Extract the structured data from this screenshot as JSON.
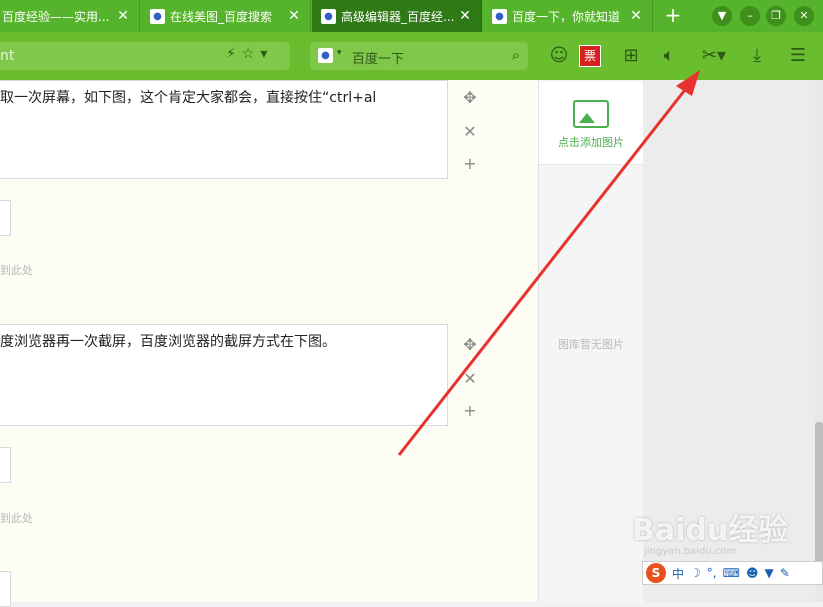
{
  "tabs": [
    {
      "title": "百度经验——实用..."
    },
    {
      "title": "在线美图_百度搜索"
    },
    {
      "title": "高级编辑器_百度经..."
    },
    {
      "title": "百度一下，你就知道"
    }
  ],
  "address": {
    "value": "nt"
  },
  "search": {
    "placeholder": "百度一下"
  },
  "toolbar": {
    "ticket": "票"
  },
  "editor": {
    "block1_text": "取一次屏幕，如下图，这个肯定大家都会，直接按住“ctrl+al",
    "block1_hint": "到此处",
    "block2_text": "度浏览器再一次截屏，百度浏览器的截屏方式在下图。",
    "block2_hint": "到此处"
  },
  "sidebar": {
    "add_image": "点击添加图片",
    "empty": "图库暂无图片"
  },
  "watermark": {
    "brand": "Baidu经验",
    "url": "jingyan.baidu.com"
  },
  "ime": {
    "s": "S",
    "mode": "中"
  }
}
